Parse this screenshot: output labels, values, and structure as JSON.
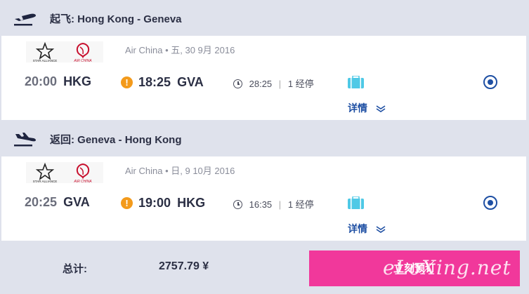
{
  "outbound": {
    "header_prefix": "起飞:",
    "route": "Hong Kong - Geneva",
    "airline": "Air China",
    "date": "五, 30 9月 2016",
    "dep_time": "20:00",
    "dep_code": "HKG",
    "arr_time": "18:25",
    "arr_code": "GVA",
    "duration": "28:25",
    "stops": "1 经停",
    "details_label": "详情"
  },
  "inbound": {
    "header_prefix": "返回:",
    "route": "Geneva - Hong Kong",
    "airline": "Air China",
    "date": "日, 9 10月 2016",
    "dep_time": "20:25",
    "dep_code": "GVA",
    "arr_time": "19:00",
    "arr_code": "HKG",
    "duration": "16:35",
    "stops": "1 经停",
    "details_label": "详情"
  },
  "footer": {
    "total_label": "总计:",
    "total_value": "2757.79 ¥",
    "book_label": "立刻预订",
    "watermark": "eLoXing.net"
  },
  "icons": {
    "takeoff": "plane-takeoff-icon",
    "landing": "plane-landing-icon",
    "warning": "warning-icon",
    "clock": "clock-icon",
    "baggage": "baggage-icon",
    "chevron": "chevron-down-icon",
    "radio": "radio-selected-icon"
  },
  "colors": {
    "background": "#dfe2ec",
    "accent_blue": "#1e4fa3",
    "warning_orange": "#f39a1b",
    "book_pink": "#f1389b",
    "baggage_cyan": "#4fc9e6"
  }
}
